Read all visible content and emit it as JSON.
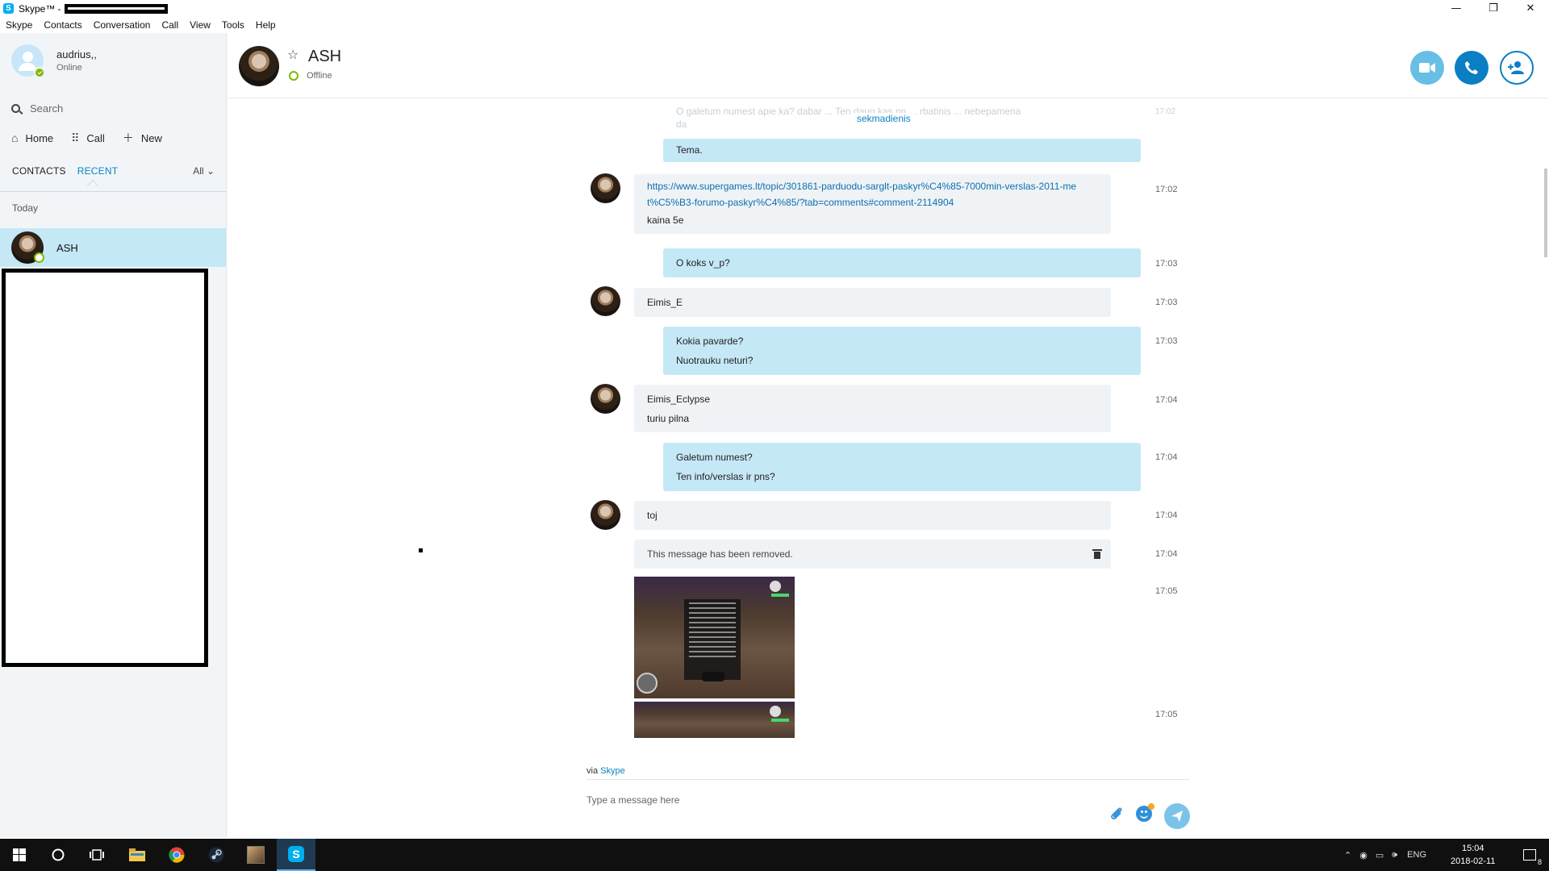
{
  "window": {
    "title": "Skype™ -",
    "controls": {
      "minimize": "—",
      "restore": "❐",
      "close": "✕"
    }
  },
  "menu": [
    "Skype",
    "Contacts",
    "Conversation",
    "Call",
    "View",
    "Tools",
    "Help"
  ],
  "sidebar": {
    "user": {
      "name": "audrius,,",
      "status": "Online"
    },
    "search_placeholder": "Search",
    "nav": {
      "home": "Home",
      "call": "Call",
      "new": "New"
    },
    "tabs": {
      "contacts": "CONTACTS",
      "recent": "RECENT",
      "filter": "All"
    },
    "section": "Today",
    "recent": [
      {
        "name": "ASH"
      }
    ]
  },
  "conversation": {
    "contact_name": "ASH",
    "contact_status": "Offline",
    "day_separator": "sekmadienis",
    "ghost_text": "O galetum numest apie ka? dabar ... Ten daug kas pn ... rbatinis ... nebepamena",
    "ghost_text2": "da",
    "ghost_time": "17:02",
    "messages": {
      "m1": {
        "text": "Tema."
      },
      "m2": {
        "link": "https://www.supergames.lt/topic/301861-parduodu-sarglt-paskyr%C4%85-7000min-verslas-2011-met%C5%B3-forumo-paskyr%C4%85/?tab=comments#comment-2114904",
        "text": "kaina 5e",
        "time": "17:02"
      },
      "m3": {
        "text": "O koks v_p?",
        "time": "17:03"
      },
      "m4": {
        "text": "Eimis_E",
        "time": "17:03"
      },
      "m5": {
        "line1": "Kokia pavarde?",
        "line2": "Nuotrauku neturi?",
        "time": "17:03"
      },
      "m6": {
        "line1": " Eimis_Eclypse",
        "line2": "turiu pilna",
        "time": "17:04"
      },
      "m7": {
        "line1": "Galetum numest?",
        "line2": "Ten info/verslas ir pns?",
        "time": "17:04"
      },
      "m8": {
        "text": "toj",
        "time": "17:04"
      },
      "m9": {
        "text": "This message has been removed.",
        "time": "17:04"
      },
      "m10": {
        "time": "17:05"
      },
      "m11": {
        "time": "17:05"
      }
    },
    "via_prefix": "via",
    "via_link": "Skype",
    "input_placeholder": "Type a message here"
  },
  "taskbar": {
    "language": "ENG",
    "time": "15:04",
    "date": "2018-02-11",
    "notification_count": "8"
  },
  "colors": {
    "accent": "#0a82c4",
    "outgoing_bubble": "#c5e8f7",
    "incoming_bubble": "#f0f3f6",
    "online": "#7fba00"
  }
}
